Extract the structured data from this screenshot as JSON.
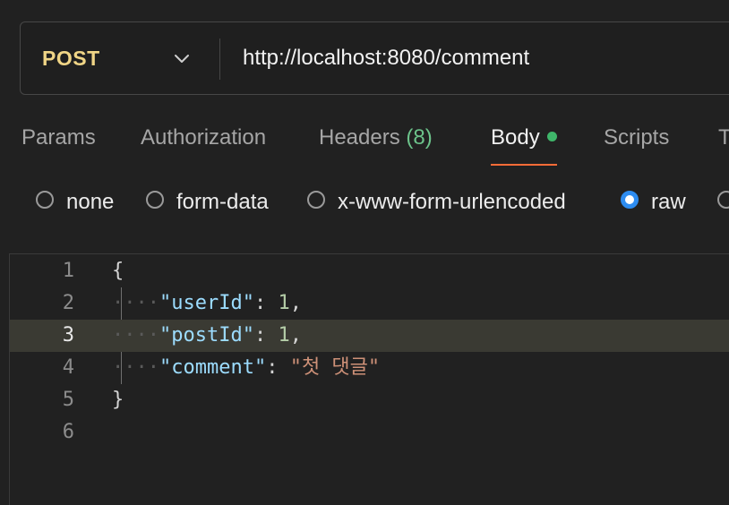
{
  "request": {
    "method": "POST",
    "url": "http://localhost:8080/comment"
  },
  "tabs": [
    {
      "label": "Params"
    },
    {
      "label": "Authorization"
    },
    {
      "label": "Headers",
      "count": "(8)"
    },
    {
      "label": "Body",
      "active": true
    },
    {
      "label": "Scripts"
    },
    {
      "label": "T"
    }
  ],
  "body_types": [
    {
      "label": "none",
      "selected": false
    },
    {
      "label": "form-data",
      "selected": false
    },
    {
      "label": "x-www-form-urlencoded",
      "selected": false
    },
    {
      "label": "raw",
      "selected": true
    }
  ],
  "editor": {
    "line_numbers": [
      "1",
      "2",
      "3",
      "4",
      "5",
      "6"
    ],
    "current_line": 3,
    "open_brace": "{",
    "close_brace": "}",
    "fields": [
      {
        "key": "\"userId\"",
        "value": "1",
        "trailing": ","
      },
      {
        "key": "\"postId\"",
        "value": "1",
        "trailing": ","
      },
      {
        "key": "\"comment\"",
        "value": "\"첫 댓글\"",
        "trailing": ""
      }
    ]
  },
  "colors": {
    "method": "#f0d586",
    "active_tab_underline": "#ff6c37",
    "body_dot": "#3fb66a",
    "radio_selected": "#2d8cf0",
    "json_key": "#9cdcfe",
    "json_number": "#b5cea8",
    "json_string": "#ce9178"
  }
}
